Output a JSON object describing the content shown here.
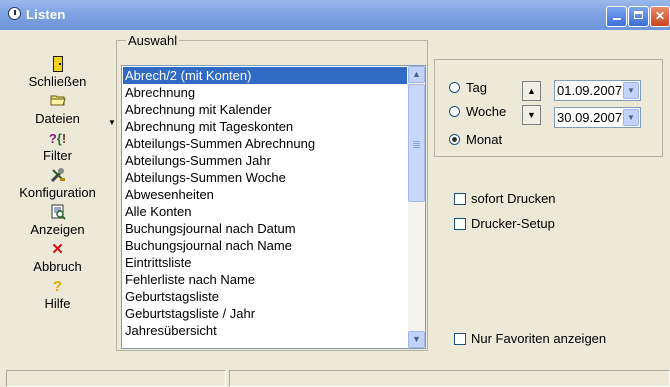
{
  "window": {
    "title": "Listen"
  },
  "toolbar": {
    "items": [
      {
        "label": "Schließen",
        "icon": "door-exit-icon"
      },
      {
        "label": "Dateien",
        "icon": "folder-icon"
      },
      {
        "label": "Filter",
        "icon": "filter-icon"
      },
      {
        "label": "Konfiguration",
        "icon": "tools-config-icon"
      },
      {
        "label": "Anzeigen",
        "icon": "preview-icon"
      },
      {
        "label": "Abbruch",
        "icon": "cancel-x-icon"
      },
      {
        "label": "Hilfe",
        "icon": "help-question-icon"
      }
    ]
  },
  "selection": {
    "group_title": "Auswahl",
    "selected_index": 0,
    "items": [
      "Abrech/2 (mit Konten)",
      "Abrechnung",
      "Abrechnung mit Kalender",
      "Abrechnung mit Tageskonten",
      "Abteilungs-Summen Abrechnung",
      "Abteilungs-Summen Jahr",
      "Abteilungs-Summen Woche",
      "Abwesenheiten",
      "Alle Konten",
      "Buchungsjournal nach Datum",
      "Buchungsjournal nach Name",
      "Eintrittsliste",
      "Fehlerliste nach Name",
      "Geburtstagsliste",
      "Geburtstagsliste / Jahr",
      "Jahresübersicht"
    ]
  },
  "period": {
    "options": [
      {
        "label": "Tag",
        "checked": false
      },
      {
        "label": "Woche",
        "checked": false
      },
      {
        "label": "Monat",
        "checked": true
      }
    ],
    "date_from": "01.09.2007",
    "date_to": "30.09.2007"
  },
  "print_options": {
    "sofort_drucken": {
      "label": "sofort Drucken",
      "checked": false
    },
    "drucker_setup": {
      "label": "Drucker-Setup",
      "checked": false
    },
    "nur_favoriten": {
      "label": "Nur Favoriten anzeigen",
      "checked": false
    }
  },
  "colors": {
    "titlebar": "#7fa3e3",
    "selection": "#316ac5",
    "window_bg": "#ece9d8"
  }
}
